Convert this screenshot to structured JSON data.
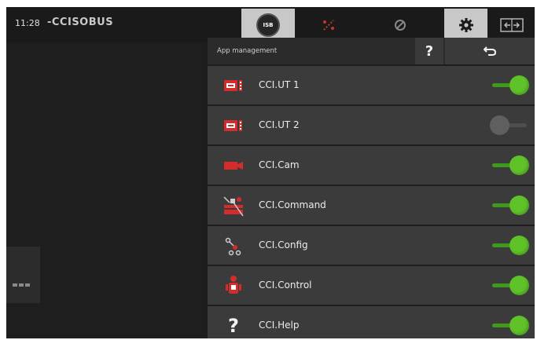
{
  "status_bar": {
    "time": "11:28",
    "brand": "-CCISOBUS",
    "isb_label": "ISB",
    "icons": [
      "isb-icon",
      "shortcut-icon",
      "no-entry-icon",
      "gear-icon",
      "switch-arrows-icon"
    ]
  },
  "panel": {
    "title": "App management",
    "help_label": "?",
    "back_icon": "return-arrow-icon"
  },
  "apps": [
    {
      "name": "CCI.UT 1",
      "icon": "terminal-icon",
      "enabled": true
    },
    {
      "name": "CCI.UT 2",
      "icon": "terminal-icon",
      "enabled": false
    },
    {
      "name": "CCI.Cam",
      "icon": "camera-icon",
      "enabled": true
    },
    {
      "name": "CCI.Command",
      "icon": "command-icon",
      "enabled": true
    },
    {
      "name": "CCI.Config",
      "icon": "config-icon",
      "enabled": true
    },
    {
      "name": "CCI.Control",
      "icon": "control-icon",
      "enabled": true
    },
    {
      "name": "CCI.Help",
      "icon": "help-icon",
      "enabled": true
    }
  ],
  "colors": {
    "toggle_on": "#5fc228",
    "toggle_off": "#5f5f5f",
    "accent_red": "#d42b2b",
    "background": "#1d1d1d"
  }
}
